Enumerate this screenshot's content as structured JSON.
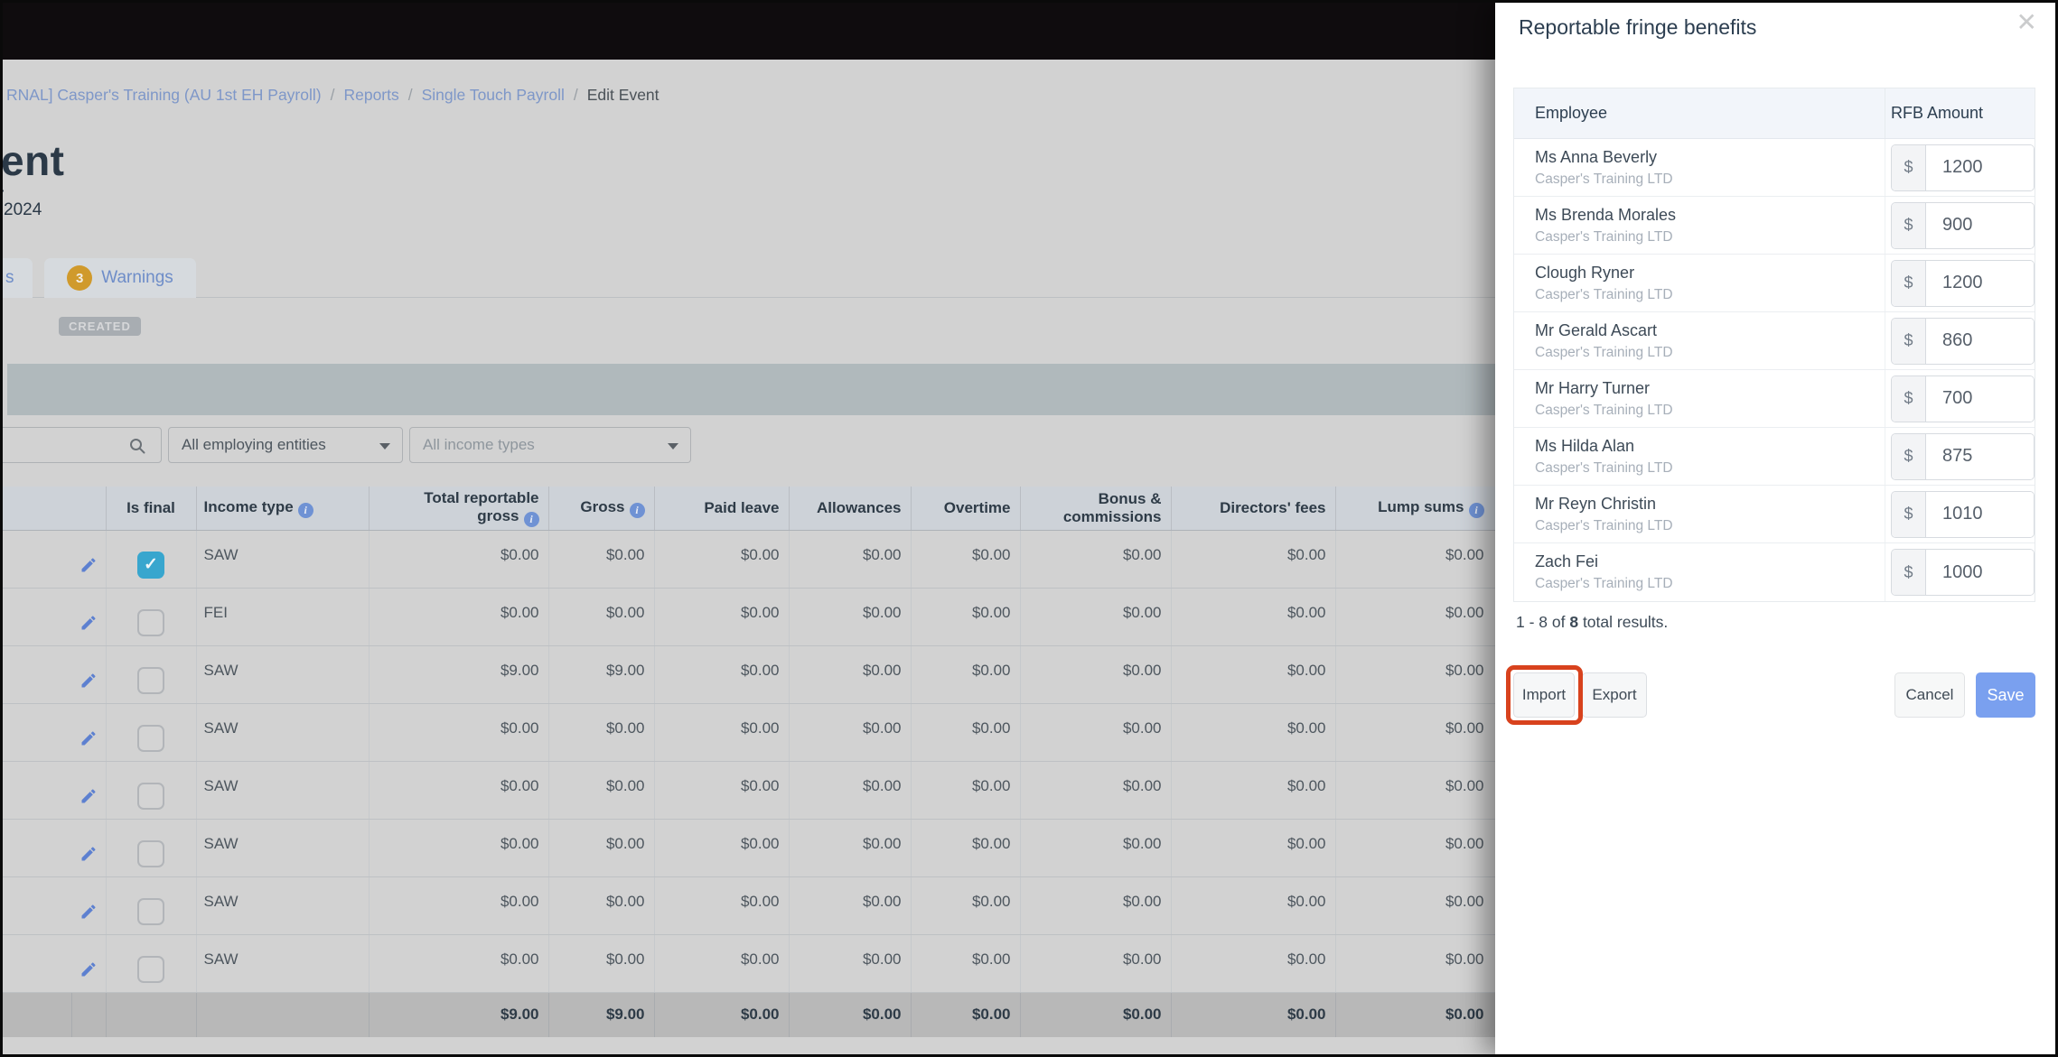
{
  "colors": {
    "save_button_blue": "#7aa0ef",
    "warnings_badge_orange": "#d09a2c",
    "import_highlight_red": "#d8421d",
    "checkbox_checked_blue": "#38a6ce",
    "link_blue": "#7e97c8"
  },
  "page": {
    "breadcrumb": {
      "items": [
        {
          "label": "RNAL] Casper's Training (AU 1st EH Payroll)"
        },
        {
          "label": "Reports"
        },
        {
          "label": "Single Touch Payroll"
        }
      ],
      "separator": "/",
      "current": "Edit Event"
    },
    "title_fragment": "ent",
    "date_fragment_partial": "4",
    "date_fragment": "2024",
    "tabs": {
      "partial_tab_label": "s",
      "warnings_count": "3",
      "warnings_label": "Warnings"
    },
    "status_badge": "CREATED",
    "filters": {
      "search_placeholder": "",
      "entities_dropdown": "All employing entities",
      "income_types_dropdown": "All income types"
    },
    "table": {
      "columns": [
        {
          "key": "blank",
          "label": "",
          "type": "blank"
        },
        {
          "key": "edit",
          "label": "",
          "type": "edit"
        },
        {
          "key": "is_final",
          "label": "Is final",
          "type": "checkbox",
          "align": "center"
        },
        {
          "key": "income_type",
          "label": "Income type",
          "info": true,
          "type": "text",
          "align": "left"
        },
        {
          "key": "total_reportable_gross",
          "label_lines": [
            "Total reportable",
            "gross"
          ],
          "info": true,
          "type": "num",
          "align": "right"
        },
        {
          "key": "gross",
          "label": "Gross",
          "info": true,
          "type": "num",
          "align": "right"
        },
        {
          "key": "paid_leave",
          "label": "Paid leave",
          "type": "num",
          "align": "right"
        },
        {
          "key": "allowances",
          "label": "Allowances",
          "type": "num",
          "align": "right"
        },
        {
          "key": "overtime",
          "label": "Overtime",
          "type": "num",
          "align": "right"
        },
        {
          "key": "bonus_commissions",
          "label_lines": [
            "Bonus &",
            "commissions"
          ],
          "type": "num",
          "align": "right"
        },
        {
          "key": "directors_fees",
          "label": "Directors' fees",
          "type": "num",
          "align": "right"
        },
        {
          "key": "lump_sums",
          "label": "Lump sums",
          "info": true,
          "type": "num",
          "align": "right",
          "clipped": true
        }
      ],
      "rows": [
        {
          "is_final": true,
          "income_type": "SAW",
          "amounts": [
            "$0.00",
            "$0.00",
            "$0.00",
            "$0.00",
            "$0.00",
            "$0.00",
            "$0.00",
            "$0.00"
          ]
        },
        {
          "is_final": false,
          "income_type": "FEI",
          "amounts": [
            "$0.00",
            "$0.00",
            "$0.00",
            "$0.00",
            "$0.00",
            "$0.00",
            "$0.00",
            "$0.00"
          ]
        },
        {
          "is_final": false,
          "income_type": "SAW",
          "amounts": [
            "$9.00",
            "$9.00",
            "$0.00",
            "$0.00",
            "$0.00",
            "$0.00",
            "$0.00",
            "$0.00"
          ]
        },
        {
          "is_final": false,
          "income_type": "SAW",
          "amounts": [
            "$0.00",
            "$0.00",
            "$0.00",
            "$0.00",
            "$0.00",
            "$0.00",
            "$0.00",
            "$0.00"
          ]
        },
        {
          "is_final": false,
          "income_type": "SAW",
          "amounts": [
            "$0.00",
            "$0.00",
            "$0.00",
            "$0.00",
            "$0.00",
            "$0.00",
            "$0.00",
            "$0.00"
          ]
        },
        {
          "is_final": false,
          "income_type": "SAW",
          "amounts": [
            "$0.00",
            "$0.00",
            "$0.00",
            "$0.00",
            "$0.00",
            "$0.00",
            "$0.00",
            "$0.00"
          ]
        },
        {
          "is_final": false,
          "income_type": "SAW",
          "amounts": [
            "$0.00",
            "$0.00",
            "$0.00",
            "$0.00",
            "$0.00",
            "$0.00",
            "$0.00",
            "$0.00"
          ]
        },
        {
          "is_final": false,
          "income_type": "SAW",
          "amounts": [
            "$0.00",
            "$0.00",
            "$0.00",
            "$0.00",
            "$0.00",
            "$0.00",
            "$0.00",
            "$0.00"
          ]
        }
      ],
      "footer_amounts": [
        "$9.00",
        "$9.00",
        "$0.00",
        "$0.00",
        "$0.00",
        "$0.00",
        "$0.00",
        "$0.00"
      ]
    }
  },
  "modal": {
    "title": "Reportable fringe benefits",
    "close_icon": "✕",
    "table": {
      "employee_header": "Employee",
      "rfb_header": "RFB Amount",
      "rows": [
        {
          "name": "Ms Anna Beverly",
          "company": "Casper's Training LTD",
          "currency": "$",
          "amount": "1200"
        },
        {
          "name": "Ms Brenda Morales",
          "company": "Casper's Training LTD",
          "currency": "$",
          "amount": "900"
        },
        {
          "name": "Clough Ryner",
          "company": "Casper's Training LTD",
          "currency": "$",
          "amount": "1200"
        },
        {
          "name": "Mr Gerald Ascart",
          "company": "Casper's Training LTD",
          "currency": "$",
          "amount": "860"
        },
        {
          "name": "Mr Harry Turner",
          "company": "Casper's Training LTD",
          "currency": "$",
          "amount": "700"
        },
        {
          "name": "Ms Hilda Alan",
          "company": "Casper's Training LTD",
          "currency": "$",
          "amount": "875"
        },
        {
          "name": "Mr Reyn Christin",
          "company": "Casper's Training LTD",
          "currency": "$",
          "amount": "1010"
        },
        {
          "name": "Zach Fei",
          "company": "Casper's Training LTD",
          "currency": "$",
          "amount": "1000"
        }
      ]
    },
    "pagination": {
      "prefix": "1 - 8 of ",
      "bold_total": "8",
      "suffix": " total results."
    },
    "buttons": {
      "import": "Import",
      "export": "Export",
      "cancel": "Cancel",
      "save": "Save"
    }
  }
}
